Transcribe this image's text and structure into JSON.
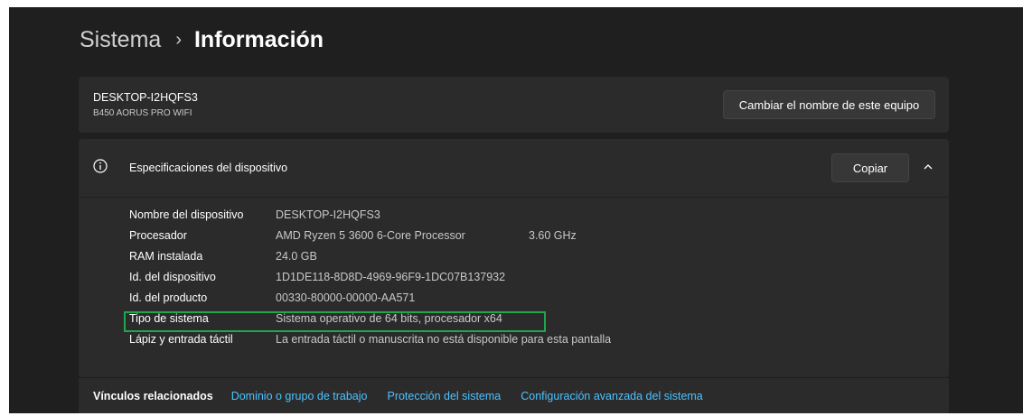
{
  "breadcrumb": {
    "parent": "Sistema",
    "separator": "›",
    "current": "Información"
  },
  "device_card": {
    "name": "DESKTOP-I2HQFS3",
    "model": "B450 AORUS PRO WIFI",
    "rename_button": "Cambiar el nombre de este equipo"
  },
  "specs": {
    "icon": "info-icon",
    "title": "Especificaciones del dispositivo",
    "copy_button": "Copiar",
    "expanded": true,
    "rows": [
      {
        "label": "Nombre del dispositivo",
        "value": "DESKTOP-I2HQFS3",
        "extra": ""
      },
      {
        "label": "Procesador",
        "value": "AMD Ryzen 5 3600 6-Core Processor",
        "extra": "3.60 GHz"
      },
      {
        "label": "RAM instalada",
        "value": "24.0 GB",
        "extra": ""
      },
      {
        "label": "Id. del dispositivo",
        "value": "1D1DE118-8D8D-4969-96F9-1DC07B137932",
        "extra": ""
      },
      {
        "label": "Id. del producto",
        "value": "00330-80000-00000-AA571",
        "extra": ""
      },
      {
        "label": "Tipo de sistema",
        "value": "Sistema operativo de 64 bits, procesador x64",
        "extra": ""
      },
      {
        "label": "Lápiz y entrada táctil",
        "value": "La entrada táctil o manuscrita no está disponible para esta pantalla",
        "extra": ""
      }
    ]
  },
  "related_links": {
    "label": "Vínculos relacionados",
    "links": [
      "Dominio o grupo de trabajo",
      "Protección del sistema",
      "Configuración avanzada del sistema"
    ]
  },
  "colors": {
    "background": "#1f1f1f",
    "card": "#2b2b2b",
    "link": "#4cc2ff",
    "highlight_box": "#21a64f"
  }
}
